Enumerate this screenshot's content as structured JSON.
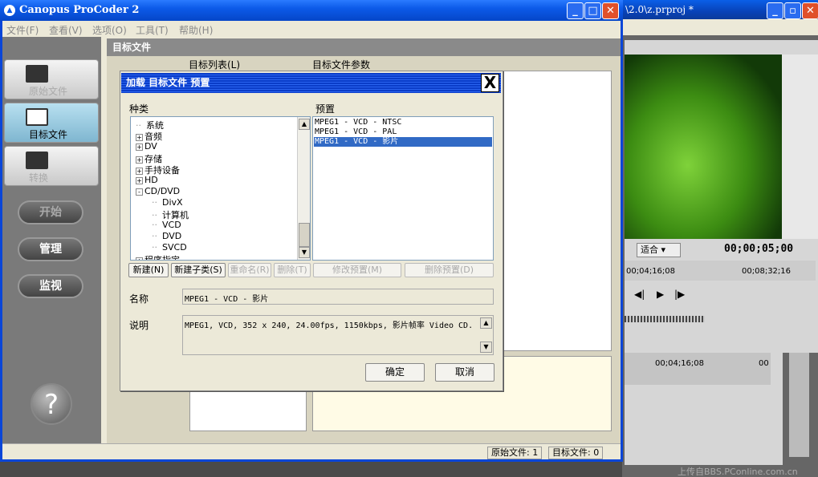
{
  "background_window": {
    "title": "\\2.0\\z.prproj *",
    "fit_select": "适合",
    "timecode_main": "00;00;05;00",
    "timecode_left": "00;04;16;08",
    "timecode_right": "00;08;32;16",
    "timeline_time": "00;04;16;08",
    "timeline_time2": "00"
  },
  "app": {
    "title": "Canopus ProCoder 2"
  },
  "menu": [
    "文件(F)",
    "查看(V)",
    "选项(O)",
    "工具(T)",
    "帮助(H)"
  ],
  "nav": {
    "source": "原始文件",
    "target": "目标文件",
    "convert": "转换"
  },
  "actions": {
    "start": "开始",
    "manage": "管理",
    "monitor": "监视"
  },
  "help_label": "?",
  "panel": {
    "header": "目标文件",
    "list_header": "目标列表(L)",
    "params_header": "目标文件参数"
  },
  "status": {
    "source": "原始文件: 1",
    "target": "目标文件: 0"
  },
  "dialog": {
    "title": "加载 目标文件 预置",
    "close": "X",
    "category_label": "种类",
    "preset_label": "预置",
    "tree": [
      {
        "label": "系统",
        "toggle": "",
        "indent": 0
      },
      {
        "label": "音频",
        "toggle": "+",
        "indent": 0
      },
      {
        "label": "DV",
        "toggle": "+",
        "indent": 0
      },
      {
        "label": "存储",
        "toggle": "+",
        "indent": 0
      },
      {
        "label": "手持设备",
        "toggle": "+",
        "indent": 0
      },
      {
        "label": "HD",
        "toggle": "+",
        "indent": 0
      },
      {
        "label": "CD/DVD",
        "toggle": "-",
        "indent": 0
      },
      {
        "label": "DivX",
        "toggle": "",
        "indent": 1
      },
      {
        "label": "计算机",
        "toggle": "",
        "indent": 1
      },
      {
        "label": "VCD",
        "toggle": "",
        "indent": 1
      },
      {
        "label": "DVD",
        "toggle": "",
        "indent": 1
      },
      {
        "label": "SVCD",
        "toggle": "",
        "indent": 1
      },
      {
        "label": "程序指定",
        "toggle": "+",
        "indent": 0
      }
    ],
    "presets": [
      {
        "label": "MPEG1 - VCD - NTSC",
        "selected": false
      },
      {
        "label": "MPEG1 - VCD - PAL",
        "selected": false
      },
      {
        "label": "MPEG1 - VCD - 影片",
        "selected": true
      }
    ],
    "buttons": {
      "new": "新建(N)",
      "new_sub": "新建子类(S)",
      "rename": "重命名(R)",
      "delete": "删除(T)",
      "modify_preset": "修改预置(M)",
      "delete_preset": "删除预置(D)"
    },
    "name_label": "名称",
    "name_value": "MPEG1 - VCD - 影片",
    "desc_label": "说明",
    "desc_value": "MPEG1, VCD, 352 x 240, 24.00fps, 1150kbps, 影片帧率 Video CD.",
    "ok": "确定",
    "cancel": "取消"
  },
  "watermark": "上传自BBS.PConline.com.cn"
}
